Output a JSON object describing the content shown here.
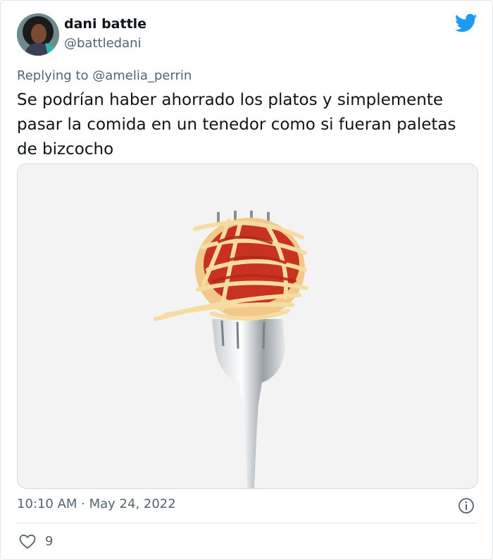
{
  "tweet": {
    "author_name": "dani battle",
    "author_handle": "@battledani",
    "replying_prefix": "Replying to ",
    "replying_to": "@amelia_perrin",
    "text": "Se podrían haber ahorrado los platos y simplemente pasar la comida en un tenedor como si fueran paletas de bizcocho",
    "timestamp": "10:10 AM · May 24, 2022",
    "like_count": "9"
  },
  "icons": {
    "brand": "twitter-bird-icon",
    "info": "info-icon",
    "like": "heart-icon"
  },
  "colors": {
    "twitter_blue": "#1d9bf0",
    "secondary_text": "#536471",
    "primary_text": "#0f1419"
  }
}
